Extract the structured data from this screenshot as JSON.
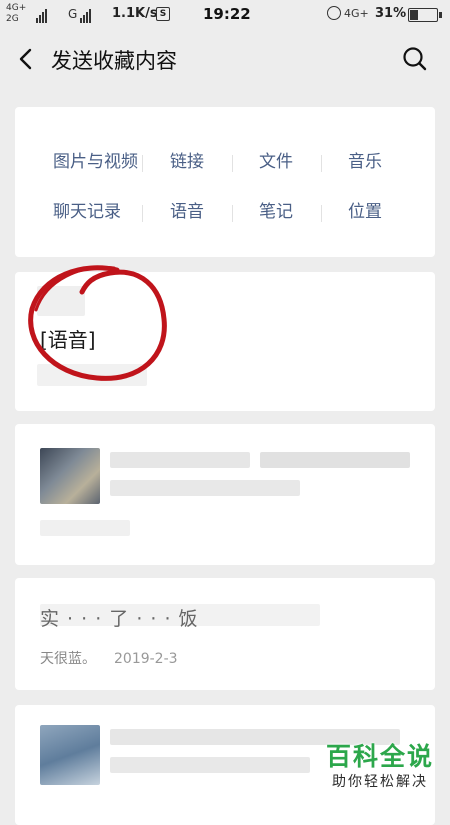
{
  "status_bar": {
    "network_top": "4G+",
    "network_bottom": "2G",
    "g_label": "G",
    "speed": "1.1K/s",
    "s_badge": "S",
    "time": "19:22",
    "network_right": "4G+",
    "battery": "31%"
  },
  "header": {
    "title": "发送收藏内容"
  },
  "categories": {
    "row1": [
      "图片与视频",
      "链接",
      "文件",
      "音乐"
    ],
    "row2": [
      "聊天记录",
      "语音",
      "笔记",
      "位置"
    ]
  },
  "favorites": {
    "voice_item": {
      "label": "[语音]"
    },
    "article_item": {
      "title": "实 · · · 了 · · · 饭",
      "source": "天很蓝。",
      "date": "2019-2-3"
    }
  },
  "watermark": {
    "title": "百科全说",
    "subtitle": "助你轻松解决"
  },
  "colors": {
    "background": "#ededed",
    "category_text": "#4a5f86",
    "circle_annotation": "#c0141b",
    "watermark_green": "#2ca74b"
  }
}
